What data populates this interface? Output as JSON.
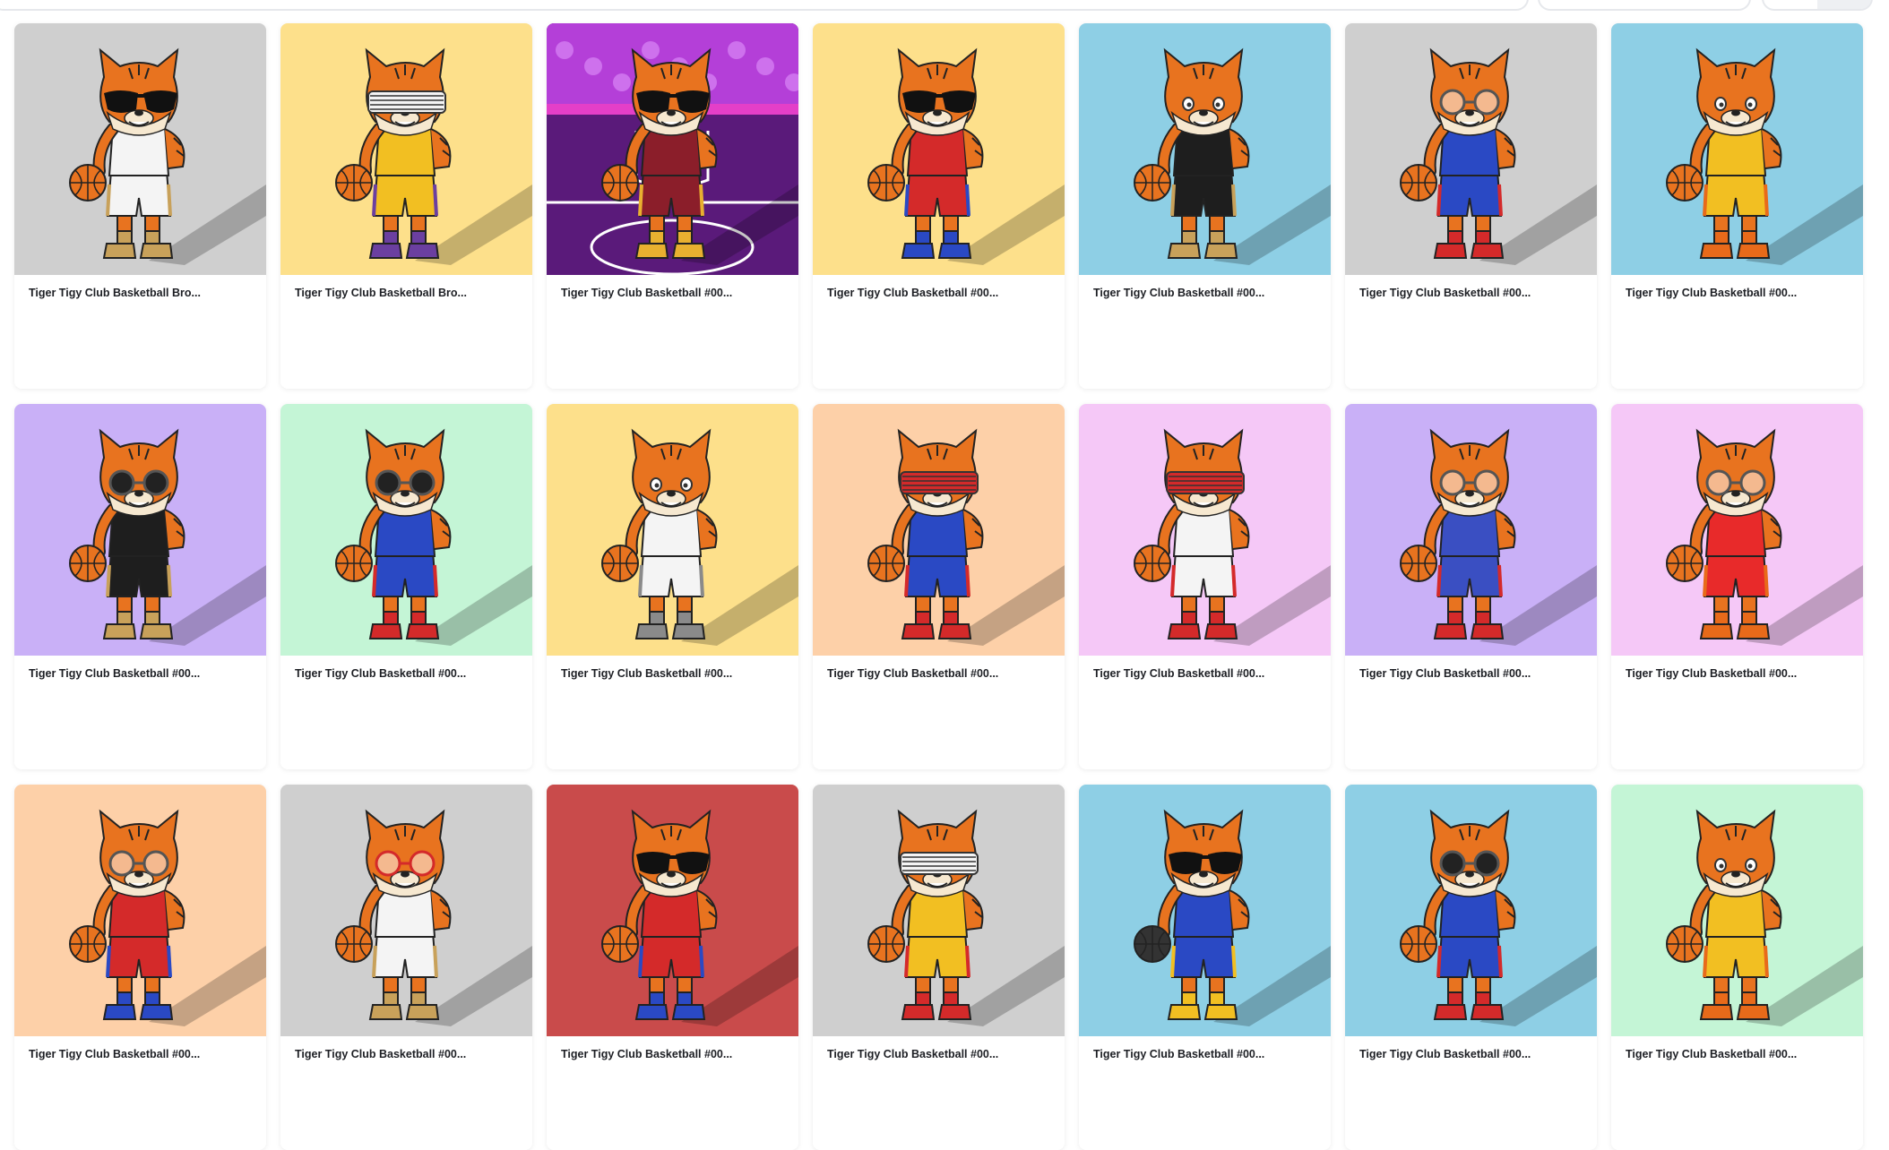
{
  "cards": [
    {
      "title": "Tiger Tigy Club Basketball Bro...",
      "bg": "#cfcfcf",
      "jersey": "#f4f4f4",
      "trim": "#c8a15a",
      "glasses": "sunglasses"
    },
    {
      "title": "Tiger Tigy Club Basketball Bro...",
      "bg": "#fde08b",
      "jersey": "#f2bf22",
      "trim": "#6b3fa0",
      "glasses": "shutter"
    },
    {
      "title": "Tiger Tigy Club Basketball #00...",
      "bg": "#5a1a7a",
      "jersey": "#8b1e2a",
      "trim": "#e8b030",
      "glasses": "sunglasses"
    },
    {
      "title": "Tiger Tigy Club Basketball #00...",
      "bg": "#fde08b",
      "jersey": "#d42a2a",
      "trim": "#2a49c4",
      "glasses": "sunglasses"
    },
    {
      "title": "Tiger Tigy Club Basketball #00...",
      "bg": "#8ecfe5",
      "jersey": "#1e1e1e",
      "trim": "#c8a15a",
      "glasses": "none"
    },
    {
      "title": "Tiger Tigy Club Basketball #00...",
      "bg": "#cfcfcf",
      "jersey": "#2a49c4",
      "trim": "#d42a2a",
      "glasses": "round"
    },
    {
      "title": "Tiger Tigy Club Basketball #00...",
      "bg": "#8ecfe5",
      "jersey": "#f2bf22",
      "trim": "#e86a1a",
      "glasses": "none"
    },
    {
      "title": "Tiger Tigy Club Basketball #00...",
      "bg": "#c9b0f7",
      "jersey": "#1e1e1e",
      "trim": "#c8a15a",
      "glasses": "round-dark"
    },
    {
      "title": "Tiger Tigy Club Basketball #00...",
      "bg": "#c4f5d6",
      "jersey": "#2a49c4",
      "trim": "#d42a2a",
      "glasses": "round-dark"
    },
    {
      "title": "Tiger Tigy Club Basketball #00...",
      "bg": "#fde08b",
      "jersey": "#f4f4f4",
      "trim": "#8a8a8a",
      "glasses": "none"
    },
    {
      "title": "Tiger Tigy Club Basketball #00...",
      "bg": "#fdd0a8",
      "jersey": "#2a49c4",
      "trim": "#d42a2a",
      "glasses": "shutter-red"
    },
    {
      "title": "Tiger Tigy Club Basketball #00...",
      "bg": "#f5c8f7",
      "jersey": "#f4f4f4",
      "trim": "#d42a2a",
      "glasses": "shutter-red"
    },
    {
      "title": "Tiger Tigy Club Basketball #00...",
      "bg": "#c9b0f7",
      "jersey": "#3a4fc2",
      "trim": "#d42a2a",
      "glasses": "round"
    },
    {
      "title": "Tiger Tigy Club Basketball #00...",
      "bg": "#f5c8f7",
      "jersey": "#e82a2a",
      "trim": "#e86a1a",
      "glasses": "round"
    },
    {
      "title": "Tiger Tigy Club Basketball #00...",
      "bg": "#fdd0a8",
      "jersey": "#d42a2a",
      "trim": "#2a49c4",
      "glasses": "round"
    },
    {
      "title": "Tiger Tigy Club Basketball #00...",
      "bg": "#cfcfcf",
      "jersey": "#f4f4f4",
      "trim": "#c8a15a",
      "glasses": "round-red"
    },
    {
      "title": "Tiger Tigy Club Basketball #00...",
      "bg": "#c94b4b",
      "jersey": "#d42a2a",
      "trim": "#2a49c4",
      "glasses": "sunglasses"
    },
    {
      "title": "Tiger Tigy Club Basketball #00...",
      "bg": "#cfcfcf",
      "jersey": "#f2bf22",
      "trim": "#d42a2a",
      "glasses": "shutter"
    },
    {
      "title": "Tiger Tigy Club Basketball #00...",
      "bg": "#8ecfe5",
      "jersey": "#2a49c4",
      "trim": "#f2bf22",
      "glasses": "sunglasses"
    },
    {
      "title": "Tiger Tigy Club Basketball #00...",
      "bg": "#8ecfe5",
      "jersey": "#2a49c4",
      "trim": "#d42a2a",
      "glasses": "round-dark"
    },
    {
      "title": "Tiger Tigy Club Basketball #00...",
      "bg": "#c4f5d6",
      "jersey": "#f2bf22",
      "trim": "#e86a1a",
      "glasses": "none"
    }
  ]
}
